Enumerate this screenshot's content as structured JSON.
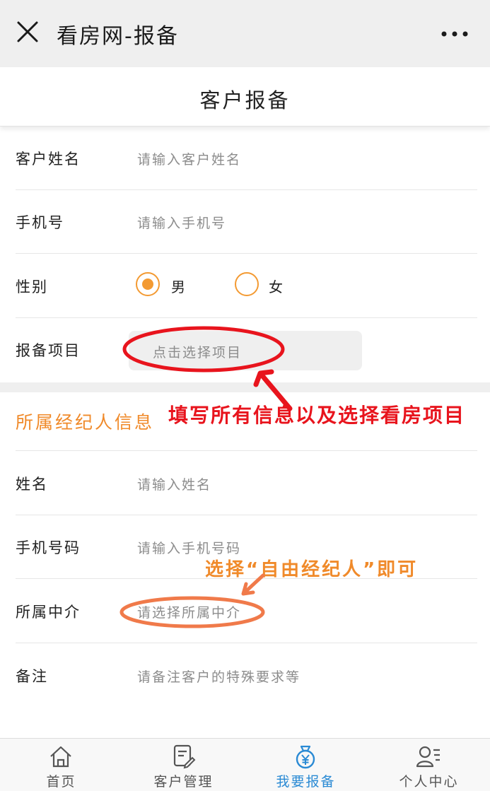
{
  "topbar": {
    "title": "看房网-报备"
  },
  "header": {
    "title": "客户报备"
  },
  "customer": {
    "name_label": "客户姓名",
    "name_placeholder": "请输入客户姓名",
    "phone_label": "手机号",
    "phone_placeholder": "请输入手机号",
    "gender_label": "性别",
    "gender_options": [
      "男",
      "女"
    ],
    "gender_selected": "男",
    "project_label": "报备项目",
    "project_placeholder": "点击选择项目"
  },
  "agent": {
    "section_title": "所属经纪人信息",
    "name_label": "姓名",
    "name_placeholder": "请输入姓名",
    "phone_label": "手机号码",
    "phone_placeholder": "请输入手机号码",
    "agency_label": "所属中介",
    "agency_placeholder": "请选择所属中介",
    "remark_label": "备注",
    "remark_placeholder": "请备注客户的特殊要求等"
  },
  "annotations": {
    "red": "填写所有信息以及选择看房项目",
    "orange": "选择“自由经纪人”即可"
  },
  "tabs": [
    {
      "label": "首页",
      "icon": "home-icon",
      "active": false
    },
    {
      "label": "客户管理",
      "icon": "edit-document-icon",
      "active": false
    },
    {
      "label": "我要报备",
      "icon": "money-bag-icon",
      "active": true
    },
    {
      "label": "个人中心",
      "icon": "user-list-icon",
      "active": false
    }
  ],
  "colors": {
    "accent_orange": "#f39a32",
    "annotation_red": "#e8141d",
    "tab_active_blue": "#2a8ad4",
    "topbar_bg": "#efefef"
  }
}
